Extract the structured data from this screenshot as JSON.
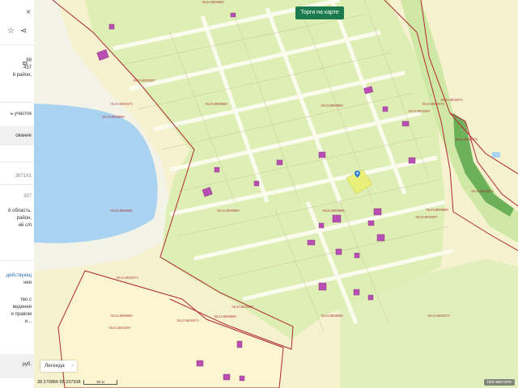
{
  "panel": {
    "close": "×",
    "star": "☆",
    "share": "⋖",
    "copy": "⧉",
    "lines": [
      {
        "text": "89",
        "cls": ""
      },
      {
        "text": "437",
        "cls": ""
      },
      {
        "text": "й район,",
        "cls": ""
      },
      {
        "text": "ь участок",
        "cls": ""
      },
      {
        "text": "ование",
        "cls": ""
      },
      {
        "text": "387161",
        "cls": "dim"
      },
      {
        "text": "397",
        "cls": "dim"
      },
      {
        "text": "й область,",
        "cls": ""
      },
      {
        "text": "район,",
        "cls": ""
      },
      {
        "text": "ий с/п",
        "cls": ""
      },
      {
        "text": "действующ",
        "cls": "link"
      },
      {
        "text": "ния",
        "cls": ""
      },
      {
        "text": "тво с",
        "cls": ""
      },
      {
        "text": "ведения",
        "cls": ""
      },
      {
        "text": "и правом",
        "cls": ""
      },
      {
        "text": "и...",
        "cls": ""
      },
      {
        "text": "руб.",
        "cls": ""
      }
    ]
  },
  "map": {
    "trade_button": "Торги на карте",
    "legend_button": "Легенда",
    "legend_chevron": "›",
    "coordinates": "38.270866  55.337938",
    "scale_label": "50 м",
    "copyright": "Іstо жит-ите",
    "parcel_labels": [
      {
        "text": "50:23:0000000",
        "color": "#a3262e"
      },
      {
        "text": "50:23:0050397",
        "color": "#a3262e"
      },
      {
        "text": "50:23:0050373",
        "color": "#a3262e"
      },
      {
        "text": "50:23:0000000",
        "color": "#a3262e"
      },
      {
        "text": "50:23:0000000",
        "color": "#a3262e"
      },
      {
        "text": "50:23:0050397",
        "color": "#a3262e"
      },
      {
        "text": "50:23:0050373",
        "color": "#a3262e"
      },
      {
        "text": "50:23:0000000",
        "color": "#a3262e"
      },
      {
        "text": "50:23:0000000",
        "color": "#a3262e"
      },
      {
        "text": "50:23:0000000",
        "color": "#a3262e"
      },
      {
        "text": "50:23:0000000",
        "color": "#a3262e"
      },
      {
        "text": "50:23:0050397",
        "color": "#a3262e"
      },
      {
        "text": "50:23:0050373",
        "color": "#a3262e"
      },
      {
        "text": "50:23:0050373",
        "color": "#a3262e"
      },
      {
        "text": "50:23:0000000",
        "color": "#a3262e"
      },
      {
        "text": "50:23:0050397",
        "color": "#a3262e"
      },
      {
        "text": "50:23:0050373",
        "color": "#a3262e"
      },
      {
        "text": "50:23:0000000",
        "color": "#a3262e"
      },
      {
        "text": "50:23:0050397",
        "color": "#a3262e"
      },
      {
        "text": "50:23:0000000",
        "color": "#a3262e"
      },
      {
        "text": "50:23:0000000",
        "color": "#a3262e"
      },
      {
        "text": "50:23:0050373",
        "color": "#a3262e"
      },
      {
        "text": "50:23:0050373",
        "color": "#a3262e"
      },
      {
        "text": "50:23:0050373",
        "color": "#a3262e"
      }
    ]
  },
  "colors": {
    "water": "#a9d3f0",
    "land": "#f6f1cf",
    "green": "#d9efb0",
    "forest": "#5aa64a",
    "road": "#fbfbee",
    "boundary": "#b02a30",
    "building": "#b94fb2",
    "highlight": "#e9f07a",
    "pin": "#2e7bd6"
  }
}
